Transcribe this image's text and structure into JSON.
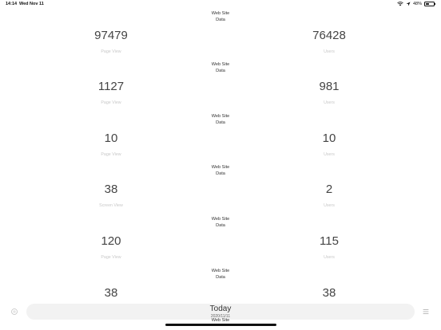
{
  "status": {
    "time": "14:14",
    "date": "Wed Nov 11",
    "battery": "48%",
    "battery_level": 0.48
  },
  "sections": [
    {
      "title_line1": "Web Site",
      "title_line2": "Data",
      "left_value": "97479",
      "left_label": "Page View",
      "right_value": "76428",
      "right_label": "Users"
    },
    {
      "title_line1": "Web Site",
      "title_line2": "Data",
      "left_value": "1127",
      "left_label": "Page View",
      "right_value": "981",
      "right_label": "Users"
    },
    {
      "title_line1": "Web Site",
      "title_line2": "Data",
      "left_value": "10",
      "left_label": "Page View",
      "right_value": "10",
      "right_label": "Users"
    },
    {
      "title_line1": "Web Site",
      "title_line2": "Data",
      "left_value": "38",
      "left_label": "Screen View",
      "right_value": "2",
      "right_label": "Users"
    },
    {
      "title_line1": "Web Site",
      "title_line2": "Data",
      "left_value": "120",
      "left_label": "Page View",
      "right_value": "115",
      "right_label": "Users"
    },
    {
      "title_line1": "Web Site",
      "title_line2": "Data",
      "left_value": "38",
      "left_label": "",
      "right_value": "38",
      "right_label": ""
    }
  ],
  "bottom": {
    "title": "Today",
    "date": "2020/11/11",
    "peek": "Web Site"
  },
  "icons": {
    "left": "circle-icon",
    "right": "list-icon"
  }
}
